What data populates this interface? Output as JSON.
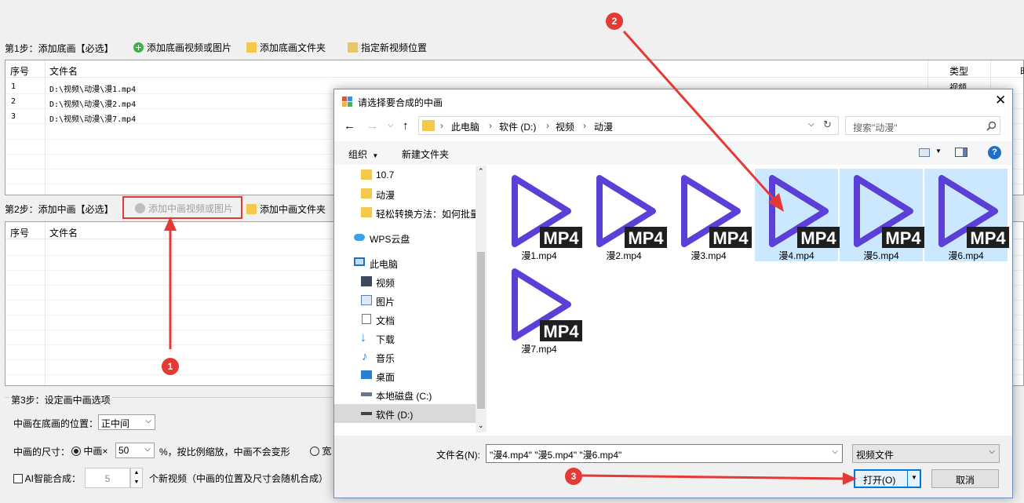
{
  "step1": {
    "label": "第1步：添加底画【必选】",
    "add_video_label": "添加底画视频或图片",
    "add_folder_label": "添加底画文件夹",
    "set_position_label": "指定新视频位置",
    "columns": [
      "序号",
      "文件名",
      "类型",
      "时"
    ],
    "rows": [
      {
        "index": "1",
        "file": "D:\\视频\\动漫\\漫1.mp4",
        "type": "视频"
      },
      {
        "index": "2",
        "file": "D:\\视频\\动漫\\漫2.mp4"
      },
      {
        "index": "3",
        "file": "D:\\视频\\动漫\\漫7.mp4"
      }
    ]
  },
  "step2": {
    "label": "第2步：添加中画【必选】",
    "add_video_label": "添加中画视频或图片",
    "add_folder_label": "添加中画文件夹",
    "columns": [
      "序号",
      "文件名"
    ]
  },
  "step3": {
    "legend": "第3步：设定画中画选项",
    "position_label": "中画在底画的位置：",
    "position_value": "正中间",
    "size_label": "中画的尺寸：",
    "size_option": "中画×",
    "size_value": "50",
    "size_suffix": "%，按比例缩放，中画不会变形",
    "width_option": "宽",
    "ai_label": "AI智能合成：",
    "ai_count": "5",
    "ai_suffix": "个新视频（中画的位置及尺寸会随机合成）"
  },
  "dialog": {
    "title": "请选择要合成的中画",
    "breadcrumb": [
      "此电脑",
      "软件 (D:)",
      "视频",
      "动漫"
    ],
    "search_placeholder": "搜索\"动漫\"",
    "organize_label": "组织",
    "new_folder_label": "新建文件夹",
    "nav": [
      {
        "label": "10.7",
        "icon": "folder-icon"
      },
      {
        "label": "动漫",
        "icon": "folder-icon"
      },
      {
        "label": "轻松转换方法：如何批量",
        "icon": "folder-icon"
      },
      {
        "label": "WPS云盘",
        "icon": "cloud-icon"
      },
      {
        "label": "此电脑",
        "icon": "computer-icon"
      },
      {
        "label": "视频",
        "icon": "video-folder-icon"
      },
      {
        "label": "图片",
        "icon": "picture-folder-icon"
      },
      {
        "label": "文档",
        "icon": "document-folder-icon"
      },
      {
        "label": "下载",
        "icon": "download-icon"
      },
      {
        "label": "音乐",
        "icon": "music-icon"
      },
      {
        "label": "桌面",
        "icon": "desktop-icon"
      },
      {
        "label": "本地磁盘 (C:)",
        "icon": "drive-icon"
      },
      {
        "label": "软件 (D:)",
        "icon": "drive-icon"
      }
    ],
    "files": [
      {
        "name": "漫1.mp4",
        "selected": false,
        "badge": "MP4"
      },
      {
        "name": "漫2.mp4",
        "selected": false,
        "badge": "MP4"
      },
      {
        "name": "漫3.mp4",
        "selected": false,
        "badge": "MP4"
      },
      {
        "name": "漫4.mp4",
        "selected": true,
        "badge": "MP4"
      },
      {
        "name": "漫5.mp4",
        "selected": true,
        "badge": "MP4"
      },
      {
        "name": "漫6.mp4",
        "selected": true,
        "badge": "MP4"
      },
      {
        "name": "漫7.mp4",
        "selected": false,
        "badge": "MP4"
      }
    ],
    "filename_label": "文件名(N):",
    "filename_value": "\"漫4.mp4\" \"漫5.mp4\" \"漫6.mp4\"",
    "filetype_value": "视频文件",
    "open_label": "打开(O)",
    "cancel_label": "取消"
  },
  "markers": [
    "1",
    "2",
    "3"
  ],
  "colors": {
    "accent": "#e53935",
    "selection": "#cce8ff",
    "play_icon": "#5b3fd6"
  }
}
